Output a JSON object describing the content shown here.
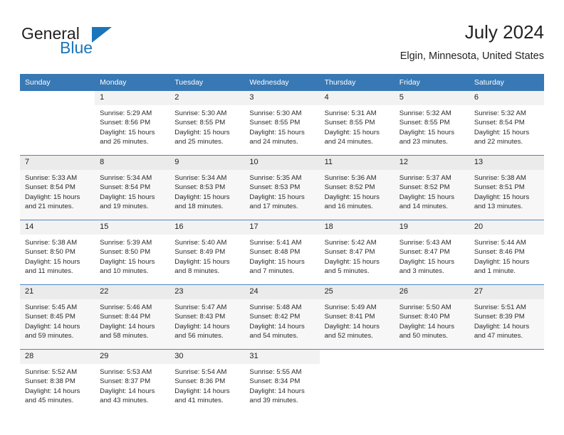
{
  "brand": {
    "name_top": "General",
    "name_bottom": "Blue",
    "triangle_color": "#1b75bb",
    "text_color": "#231f20"
  },
  "header": {
    "title": "July 2024",
    "subtitle": "Elgin, Minnesota, United States"
  },
  "theme": {
    "header_bg": "#3878b4",
    "header_text": "#ffffff",
    "daynum_bg": "#f2f2f2",
    "row_divider": "#4a86c5",
    "body_text": "#2b2b2b"
  },
  "weekdays": [
    "Sunday",
    "Monday",
    "Tuesday",
    "Wednesday",
    "Thursday",
    "Friday",
    "Saturday"
  ],
  "weeks": [
    [
      {
        "day": "",
        "sunrise": "",
        "sunset": "",
        "daylight1": "",
        "daylight2": ""
      },
      {
        "day": "1",
        "sunrise": "Sunrise: 5:29 AM",
        "sunset": "Sunset: 8:56 PM",
        "daylight1": "Daylight: 15 hours",
        "daylight2": "and 26 minutes."
      },
      {
        "day": "2",
        "sunrise": "Sunrise: 5:30 AM",
        "sunset": "Sunset: 8:55 PM",
        "daylight1": "Daylight: 15 hours",
        "daylight2": "and 25 minutes."
      },
      {
        "day": "3",
        "sunrise": "Sunrise: 5:30 AM",
        "sunset": "Sunset: 8:55 PM",
        "daylight1": "Daylight: 15 hours",
        "daylight2": "and 24 minutes."
      },
      {
        "day": "4",
        "sunrise": "Sunrise: 5:31 AM",
        "sunset": "Sunset: 8:55 PM",
        "daylight1": "Daylight: 15 hours",
        "daylight2": "and 24 minutes."
      },
      {
        "day": "5",
        "sunrise": "Sunrise: 5:32 AM",
        "sunset": "Sunset: 8:55 PM",
        "daylight1": "Daylight: 15 hours",
        "daylight2": "and 23 minutes."
      },
      {
        "day": "6",
        "sunrise": "Sunrise: 5:32 AM",
        "sunset": "Sunset: 8:54 PM",
        "daylight1": "Daylight: 15 hours",
        "daylight2": "and 22 minutes."
      }
    ],
    [
      {
        "day": "7",
        "sunrise": "Sunrise: 5:33 AM",
        "sunset": "Sunset: 8:54 PM",
        "daylight1": "Daylight: 15 hours",
        "daylight2": "and 21 minutes."
      },
      {
        "day": "8",
        "sunrise": "Sunrise: 5:34 AM",
        "sunset": "Sunset: 8:54 PM",
        "daylight1": "Daylight: 15 hours",
        "daylight2": "and 19 minutes."
      },
      {
        "day": "9",
        "sunrise": "Sunrise: 5:34 AM",
        "sunset": "Sunset: 8:53 PM",
        "daylight1": "Daylight: 15 hours",
        "daylight2": "and 18 minutes."
      },
      {
        "day": "10",
        "sunrise": "Sunrise: 5:35 AM",
        "sunset": "Sunset: 8:53 PM",
        "daylight1": "Daylight: 15 hours",
        "daylight2": "and 17 minutes."
      },
      {
        "day": "11",
        "sunrise": "Sunrise: 5:36 AM",
        "sunset": "Sunset: 8:52 PM",
        "daylight1": "Daylight: 15 hours",
        "daylight2": "and 16 minutes."
      },
      {
        "day": "12",
        "sunrise": "Sunrise: 5:37 AM",
        "sunset": "Sunset: 8:52 PM",
        "daylight1": "Daylight: 15 hours",
        "daylight2": "and 14 minutes."
      },
      {
        "day": "13",
        "sunrise": "Sunrise: 5:38 AM",
        "sunset": "Sunset: 8:51 PM",
        "daylight1": "Daylight: 15 hours",
        "daylight2": "and 13 minutes."
      }
    ],
    [
      {
        "day": "14",
        "sunrise": "Sunrise: 5:38 AM",
        "sunset": "Sunset: 8:50 PM",
        "daylight1": "Daylight: 15 hours",
        "daylight2": "and 11 minutes."
      },
      {
        "day": "15",
        "sunrise": "Sunrise: 5:39 AM",
        "sunset": "Sunset: 8:50 PM",
        "daylight1": "Daylight: 15 hours",
        "daylight2": "and 10 minutes."
      },
      {
        "day": "16",
        "sunrise": "Sunrise: 5:40 AM",
        "sunset": "Sunset: 8:49 PM",
        "daylight1": "Daylight: 15 hours",
        "daylight2": "and 8 minutes."
      },
      {
        "day": "17",
        "sunrise": "Sunrise: 5:41 AM",
        "sunset": "Sunset: 8:48 PM",
        "daylight1": "Daylight: 15 hours",
        "daylight2": "and 7 minutes."
      },
      {
        "day": "18",
        "sunrise": "Sunrise: 5:42 AM",
        "sunset": "Sunset: 8:47 PM",
        "daylight1": "Daylight: 15 hours",
        "daylight2": "and 5 minutes."
      },
      {
        "day": "19",
        "sunrise": "Sunrise: 5:43 AM",
        "sunset": "Sunset: 8:47 PM",
        "daylight1": "Daylight: 15 hours",
        "daylight2": "and 3 minutes."
      },
      {
        "day": "20",
        "sunrise": "Sunrise: 5:44 AM",
        "sunset": "Sunset: 8:46 PM",
        "daylight1": "Daylight: 15 hours",
        "daylight2": "and 1 minute."
      }
    ],
    [
      {
        "day": "21",
        "sunrise": "Sunrise: 5:45 AM",
        "sunset": "Sunset: 8:45 PM",
        "daylight1": "Daylight: 14 hours",
        "daylight2": "and 59 minutes."
      },
      {
        "day": "22",
        "sunrise": "Sunrise: 5:46 AM",
        "sunset": "Sunset: 8:44 PM",
        "daylight1": "Daylight: 14 hours",
        "daylight2": "and 58 minutes."
      },
      {
        "day": "23",
        "sunrise": "Sunrise: 5:47 AM",
        "sunset": "Sunset: 8:43 PM",
        "daylight1": "Daylight: 14 hours",
        "daylight2": "and 56 minutes."
      },
      {
        "day": "24",
        "sunrise": "Sunrise: 5:48 AM",
        "sunset": "Sunset: 8:42 PM",
        "daylight1": "Daylight: 14 hours",
        "daylight2": "and 54 minutes."
      },
      {
        "day": "25",
        "sunrise": "Sunrise: 5:49 AM",
        "sunset": "Sunset: 8:41 PM",
        "daylight1": "Daylight: 14 hours",
        "daylight2": "and 52 minutes."
      },
      {
        "day": "26",
        "sunrise": "Sunrise: 5:50 AM",
        "sunset": "Sunset: 8:40 PM",
        "daylight1": "Daylight: 14 hours",
        "daylight2": "and 50 minutes."
      },
      {
        "day": "27",
        "sunrise": "Sunrise: 5:51 AM",
        "sunset": "Sunset: 8:39 PM",
        "daylight1": "Daylight: 14 hours",
        "daylight2": "and 47 minutes."
      }
    ],
    [
      {
        "day": "28",
        "sunrise": "Sunrise: 5:52 AM",
        "sunset": "Sunset: 8:38 PM",
        "daylight1": "Daylight: 14 hours",
        "daylight2": "and 45 minutes."
      },
      {
        "day": "29",
        "sunrise": "Sunrise: 5:53 AM",
        "sunset": "Sunset: 8:37 PM",
        "daylight1": "Daylight: 14 hours",
        "daylight2": "and 43 minutes."
      },
      {
        "day": "30",
        "sunrise": "Sunrise: 5:54 AM",
        "sunset": "Sunset: 8:36 PM",
        "daylight1": "Daylight: 14 hours",
        "daylight2": "and 41 minutes."
      },
      {
        "day": "31",
        "sunrise": "Sunrise: 5:55 AM",
        "sunset": "Sunset: 8:34 PM",
        "daylight1": "Daylight: 14 hours",
        "daylight2": "and 39 minutes."
      },
      {
        "day": "",
        "sunrise": "",
        "sunset": "",
        "daylight1": "",
        "daylight2": ""
      },
      {
        "day": "",
        "sunrise": "",
        "sunset": "",
        "daylight1": "",
        "daylight2": ""
      },
      {
        "day": "",
        "sunrise": "",
        "sunset": "",
        "daylight1": "",
        "daylight2": ""
      }
    ]
  ]
}
